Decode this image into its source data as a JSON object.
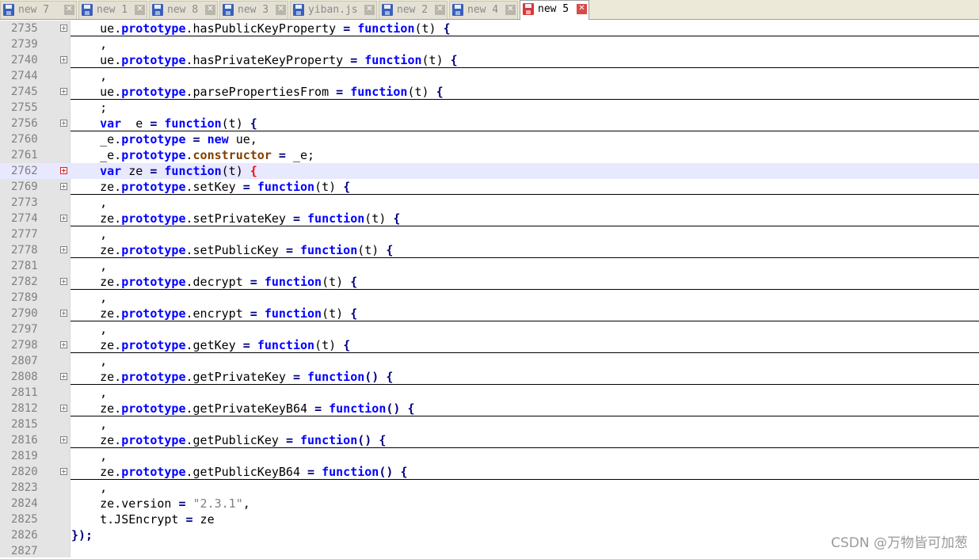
{
  "tabs": [
    {
      "label": "new 7",
      "active": false
    },
    {
      "label": "new 1",
      "active": false
    },
    {
      "label": "new 8",
      "active": false
    },
    {
      "label": "new 3",
      "active": false
    },
    {
      "label": "yiban.js",
      "active": false
    },
    {
      "label": "new 2",
      "active": false
    },
    {
      "label": "new 4",
      "active": false
    },
    {
      "label": "new 5",
      "active": true
    }
  ],
  "lines": [
    {
      "num": "2735",
      "fold": true,
      "u": true,
      "tokens": [
        [
          "ind",
          "    "
        ],
        [
          "p",
          "ue"
        ],
        [
          "p",
          "."
        ],
        [
          "kw",
          "prototype"
        ],
        [
          "p",
          ".hasPublicKeyProperty "
        ],
        [
          "kb",
          "="
        ],
        [
          "p",
          " "
        ],
        [
          "kw",
          "function"
        ],
        [
          "p",
          "(t) "
        ],
        [
          "kb",
          "{"
        ]
      ]
    },
    {
      "num": "2739",
      "fold": false,
      "u": false,
      "tokens": [
        [
          "ind",
          "    "
        ],
        [
          "p",
          ","
        ]
      ]
    },
    {
      "num": "2740",
      "fold": true,
      "u": true,
      "tokens": [
        [
          "ind",
          "    "
        ],
        [
          "p",
          "ue"
        ],
        [
          "p",
          "."
        ],
        [
          "kw",
          "prototype"
        ],
        [
          "p",
          ".hasPrivateKeyProperty "
        ],
        [
          "kb",
          "="
        ],
        [
          "p",
          " "
        ],
        [
          "kw",
          "function"
        ],
        [
          "p",
          "(t) "
        ],
        [
          "kb",
          "{"
        ]
      ]
    },
    {
      "num": "2744",
      "fold": false,
      "u": false,
      "tokens": [
        [
          "ind",
          "    "
        ],
        [
          "p",
          ","
        ]
      ]
    },
    {
      "num": "2745",
      "fold": true,
      "u": true,
      "tokens": [
        [
          "ind",
          "    "
        ],
        [
          "p",
          "ue"
        ],
        [
          "p",
          "."
        ],
        [
          "kw",
          "prototype"
        ],
        [
          "p",
          ".parsePropertiesFrom "
        ],
        [
          "kb",
          "="
        ],
        [
          "p",
          " "
        ],
        [
          "kw",
          "function"
        ],
        [
          "p",
          "(t) "
        ],
        [
          "kb",
          "{"
        ]
      ]
    },
    {
      "num": "2755",
      "fold": false,
      "u": false,
      "tokens": [
        [
          "ind",
          "    "
        ],
        [
          "p",
          ";"
        ]
      ]
    },
    {
      "num": "2756",
      "fold": true,
      "u": true,
      "tokens": [
        [
          "ind",
          "    "
        ],
        [
          "kw",
          "var"
        ],
        [
          "p",
          "  e "
        ],
        [
          "kb",
          "="
        ],
        [
          "p",
          " "
        ],
        [
          "kw",
          "function"
        ],
        [
          "p",
          "(t) "
        ],
        [
          "kb",
          "{"
        ]
      ]
    },
    {
      "num": "2760",
      "fold": false,
      "u": false,
      "tokens": [
        [
          "ind",
          "    "
        ],
        [
          "p",
          "_e."
        ],
        [
          "kw",
          "prototype"
        ],
        [
          "p",
          " "
        ],
        [
          "kb",
          "="
        ],
        [
          "p",
          " "
        ],
        [
          "kw",
          "new"
        ],
        [
          "p",
          " ue,"
        ]
      ]
    },
    {
      "num": "2761",
      "fold": false,
      "u": false,
      "tokens": [
        [
          "ind",
          "    "
        ],
        [
          "p",
          "_e."
        ],
        [
          "kw",
          "prototype"
        ],
        [
          "p",
          "."
        ],
        [
          "ctor",
          "constructor"
        ],
        [
          "p",
          " "
        ],
        [
          "kb",
          "="
        ],
        [
          "p",
          " _e;"
        ]
      ]
    },
    {
      "num": "2762",
      "fold": true,
      "u": false,
      "current": true,
      "tokens": [
        [
          "ind",
          "    "
        ],
        [
          "kw",
          "var"
        ],
        [
          "p",
          " ze "
        ],
        [
          "kb",
          "="
        ],
        [
          "p",
          " "
        ],
        [
          "kw",
          "function"
        ],
        [
          "p",
          "(t) "
        ],
        [
          "red",
          "{"
        ]
      ]
    },
    {
      "num": "2769",
      "fold": true,
      "u": true,
      "tokens": [
        [
          "ind",
          "    "
        ],
        [
          "p",
          "ze."
        ],
        [
          "kw",
          "prototype"
        ],
        [
          "p",
          ".setKey "
        ],
        [
          "kb",
          "="
        ],
        [
          "p",
          " "
        ],
        [
          "kw",
          "function"
        ],
        [
          "p",
          "(t) "
        ],
        [
          "kb",
          "{"
        ]
      ]
    },
    {
      "num": "2773",
      "fold": false,
      "u": false,
      "tokens": [
        [
          "ind",
          "    "
        ],
        [
          "p",
          ","
        ]
      ]
    },
    {
      "num": "2774",
      "fold": true,
      "u": true,
      "tokens": [
        [
          "ind",
          "    "
        ],
        [
          "p",
          "ze."
        ],
        [
          "kw",
          "prototype"
        ],
        [
          "p",
          ".setPrivateKey "
        ],
        [
          "kb",
          "="
        ],
        [
          "p",
          " "
        ],
        [
          "kw",
          "function"
        ],
        [
          "p",
          "(t) "
        ],
        [
          "kb",
          "{"
        ]
      ]
    },
    {
      "num": "2777",
      "fold": false,
      "u": false,
      "tokens": [
        [
          "ind",
          "    "
        ],
        [
          "p",
          ","
        ]
      ]
    },
    {
      "num": "2778",
      "fold": true,
      "u": true,
      "tokens": [
        [
          "ind",
          "    "
        ],
        [
          "p",
          "ze."
        ],
        [
          "kw",
          "prototype"
        ],
        [
          "p",
          ".setPublicKey "
        ],
        [
          "kb",
          "="
        ],
        [
          "p",
          " "
        ],
        [
          "kw",
          "function"
        ],
        [
          "p",
          "(t) "
        ],
        [
          "kb",
          "{"
        ]
      ]
    },
    {
      "num": "2781",
      "fold": false,
      "u": false,
      "tokens": [
        [
          "ind",
          "    "
        ],
        [
          "p",
          ","
        ]
      ]
    },
    {
      "num": "2782",
      "fold": true,
      "u": true,
      "tokens": [
        [
          "ind",
          "    "
        ],
        [
          "p",
          "ze."
        ],
        [
          "kw",
          "prototype"
        ],
        [
          "p",
          ".decrypt "
        ],
        [
          "kb",
          "="
        ],
        [
          "p",
          " "
        ],
        [
          "kw",
          "function"
        ],
        [
          "p",
          "(t) "
        ],
        [
          "kb",
          "{"
        ]
      ]
    },
    {
      "num": "2789",
      "fold": false,
      "u": false,
      "tokens": [
        [
          "ind",
          "    "
        ],
        [
          "p",
          ","
        ]
      ]
    },
    {
      "num": "2790",
      "fold": true,
      "u": true,
      "tokens": [
        [
          "ind",
          "    "
        ],
        [
          "p",
          "ze."
        ],
        [
          "kw",
          "prototype"
        ],
        [
          "p",
          ".encrypt "
        ],
        [
          "kb",
          "="
        ],
        [
          "p",
          " "
        ],
        [
          "kw",
          "function"
        ],
        [
          "p",
          "(t) "
        ],
        [
          "kb",
          "{"
        ]
      ]
    },
    {
      "num": "2797",
      "fold": false,
      "u": false,
      "tokens": [
        [
          "ind",
          "    "
        ],
        [
          "p",
          ","
        ]
      ]
    },
    {
      "num": "2798",
      "fold": true,
      "u": true,
      "tokens": [
        [
          "ind",
          "    "
        ],
        [
          "p",
          "ze."
        ],
        [
          "kw",
          "prototype"
        ],
        [
          "p",
          ".getKey "
        ],
        [
          "kb",
          "="
        ],
        [
          "p",
          " "
        ],
        [
          "kw",
          "function"
        ],
        [
          "p",
          "(t) "
        ],
        [
          "kb",
          "{"
        ]
      ]
    },
    {
      "num": "2807",
      "fold": false,
      "u": false,
      "tokens": [
        [
          "ind",
          "    "
        ],
        [
          "p",
          ","
        ]
      ]
    },
    {
      "num": "2808",
      "fold": true,
      "u": true,
      "tokens": [
        [
          "ind",
          "    "
        ],
        [
          "p",
          "ze."
        ],
        [
          "kw",
          "prototype"
        ],
        [
          "p",
          ".getPrivateKey "
        ],
        [
          "kb",
          "="
        ],
        [
          "p",
          " "
        ],
        [
          "kw",
          "function"
        ],
        [
          "kb",
          "()"
        ],
        [
          "p",
          " "
        ],
        [
          "kb",
          "{"
        ]
      ]
    },
    {
      "num": "2811",
      "fold": false,
      "u": false,
      "tokens": [
        [
          "ind",
          "    "
        ],
        [
          "p",
          ","
        ]
      ]
    },
    {
      "num": "2812",
      "fold": true,
      "u": true,
      "tokens": [
        [
          "ind",
          "    "
        ],
        [
          "p",
          "ze."
        ],
        [
          "kw",
          "prototype"
        ],
        [
          "p",
          ".getPrivateKeyB64 "
        ],
        [
          "kb",
          "="
        ],
        [
          "p",
          " "
        ],
        [
          "kw",
          "function"
        ],
        [
          "kb",
          "()"
        ],
        [
          "p",
          " "
        ],
        [
          "kb",
          "{"
        ]
      ]
    },
    {
      "num": "2815",
      "fold": false,
      "u": false,
      "tokens": [
        [
          "ind",
          "    "
        ],
        [
          "p",
          ","
        ]
      ]
    },
    {
      "num": "2816",
      "fold": true,
      "u": true,
      "tokens": [
        [
          "ind",
          "    "
        ],
        [
          "p",
          "ze."
        ],
        [
          "kw",
          "prototype"
        ],
        [
          "p",
          ".getPublicKey "
        ],
        [
          "kb",
          "="
        ],
        [
          "p",
          " "
        ],
        [
          "kw",
          "function"
        ],
        [
          "kb",
          "()"
        ],
        [
          "p",
          " "
        ],
        [
          "kb",
          "{"
        ]
      ]
    },
    {
      "num": "2819",
      "fold": false,
      "u": false,
      "tokens": [
        [
          "ind",
          "    "
        ],
        [
          "p",
          ","
        ]
      ]
    },
    {
      "num": "2820",
      "fold": true,
      "u": true,
      "tokens": [
        [
          "ind",
          "    "
        ],
        [
          "p",
          "ze."
        ],
        [
          "kw",
          "prototype"
        ],
        [
          "p",
          ".getPublicKeyB64 "
        ],
        [
          "kb",
          "="
        ],
        [
          "p",
          " "
        ],
        [
          "kw",
          "function"
        ],
        [
          "kb",
          "()"
        ],
        [
          "p",
          " "
        ],
        [
          "kb",
          "{"
        ]
      ]
    },
    {
      "num": "2823",
      "fold": false,
      "u": false,
      "tokens": [
        [
          "ind",
          "    "
        ],
        [
          "p",
          ","
        ]
      ]
    },
    {
      "num": "2824",
      "fold": false,
      "u": false,
      "tokens": [
        [
          "ind",
          "    "
        ],
        [
          "p",
          "ze.version "
        ],
        [
          "kb",
          "="
        ],
        [
          "p",
          " "
        ],
        [
          "str",
          "\"2.3.1\""
        ],
        [
          "p",
          ","
        ]
      ]
    },
    {
      "num": "2825",
      "fold": false,
      "u": false,
      "tokens": [
        [
          "ind",
          "    "
        ],
        [
          "p",
          "t.JSEncrypt "
        ],
        [
          "kb",
          "="
        ],
        [
          "p",
          " ze"
        ]
      ]
    },
    {
      "num": "2826",
      "fold": false,
      "u": false,
      "tokens": [
        [
          "kb",
          "});"
        ]
      ]
    },
    {
      "num": "2827",
      "fold": false,
      "u": false,
      "tokens": []
    }
  ],
  "watermark": "CSDN @万物皆可加葱"
}
